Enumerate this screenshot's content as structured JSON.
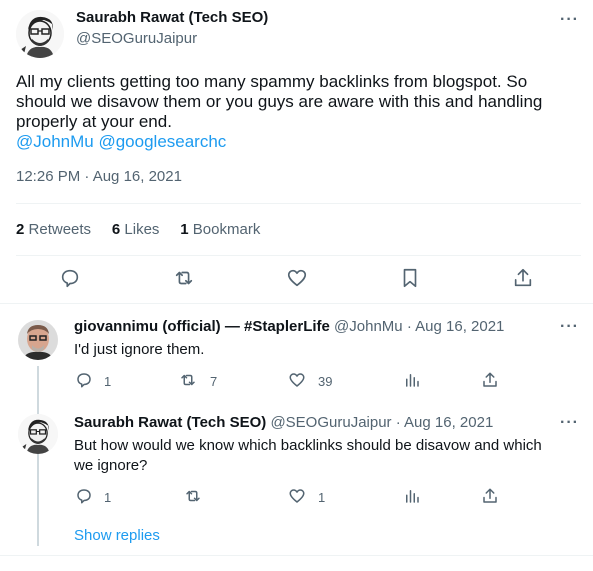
{
  "main_tweet": {
    "author_name": "Saurabh Rawat (Tech SEO)",
    "author_handle": "@SEOGuruJaipur",
    "text_lines": [
      "All my clients getting too many spammy backlinks from blogspot. So",
      "should we disavow them or you guys are aware with this and handling",
      "properly at your end."
    ],
    "mentions": "@JohnMu @googlesearchc",
    "timestamp": "12:26 PM · Aug 16, 2021",
    "retweets_count": "2",
    "retweets_label": "Retweets",
    "likes_count": "6",
    "likes_label": "Likes",
    "bookmarks_count": "1",
    "bookmarks_label": "Bookmark"
  },
  "reply1": {
    "author_name": "giovannimu (official) — #StaplerLife",
    "author_handle": "@JohnMu",
    "date": "· Aug 16, 2021",
    "text": "I'd just ignore them.",
    "reply_count": "1",
    "retweet_count": "7",
    "like_count": "39"
  },
  "reply2": {
    "author_name": "Saurabh Rawat (Tech SEO)",
    "author_handle": "@SEOGuruJaipur",
    "date": "· Aug 16, 2021",
    "text_lines": [
      "But how would we know which backlinks should be disavow and which",
      "we ignore?"
    ],
    "reply_count": "1",
    "like_count": "1"
  },
  "show_replies_label": "Show replies",
  "more_label": "···",
  "colors": {
    "accent": "#1d9bf0",
    "text": "#0f1419",
    "secondary": "#536471",
    "divider": "#eff3f4"
  }
}
